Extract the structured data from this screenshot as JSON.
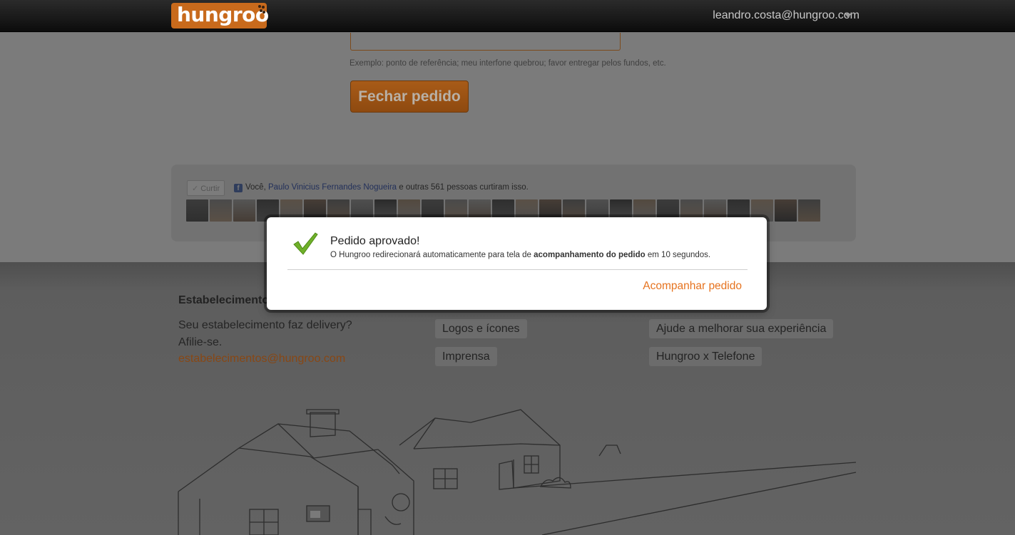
{
  "header": {
    "logo_text": "hungroo",
    "user_email": "leandro.costa@hungroo.com"
  },
  "order_form": {
    "hint": "Exemplo: ponto de referência; meu interfone quebrou; favor entregar pelos fundos, etc.",
    "close_button": "Fechar pedido"
  },
  "social": {
    "like_button": "Curtir",
    "prefix": "Você,",
    "friend_name": "Paulo Vinicius Fernandes Nogueira",
    "suffix": "e outras 561 pessoas curtiram isso.",
    "faces_count": 27
  },
  "footer": {
    "establishments": {
      "heading": "Estabelecimentos",
      "line1": "Seu estabelecimento faz delivery?",
      "line2": "Afilie-se.",
      "email": "estabelecimentos@hungroo.com"
    },
    "links_middle": [
      "Logos e ícones",
      "Imprensa"
    ],
    "links_right": [
      "Ajude a melhorar sua experiência",
      "Hungroo x Telefone"
    ]
  },
  "modal": {
    "icon": "check-icon",
    "title": "Pedido aprovado!",
    "message_start": "O Hungroo redirecionará automaticamente para tela de",
    "message_bold": "acompanhamento do pedido",
    "message_end": "em 10 segundos.",
    "action": "Acompanhar pedido"
  },
  "colors": {
    "brand_orange": "#e6731f",
    "overlay": "rgba(0,0,0,0.5)"
  }
}
